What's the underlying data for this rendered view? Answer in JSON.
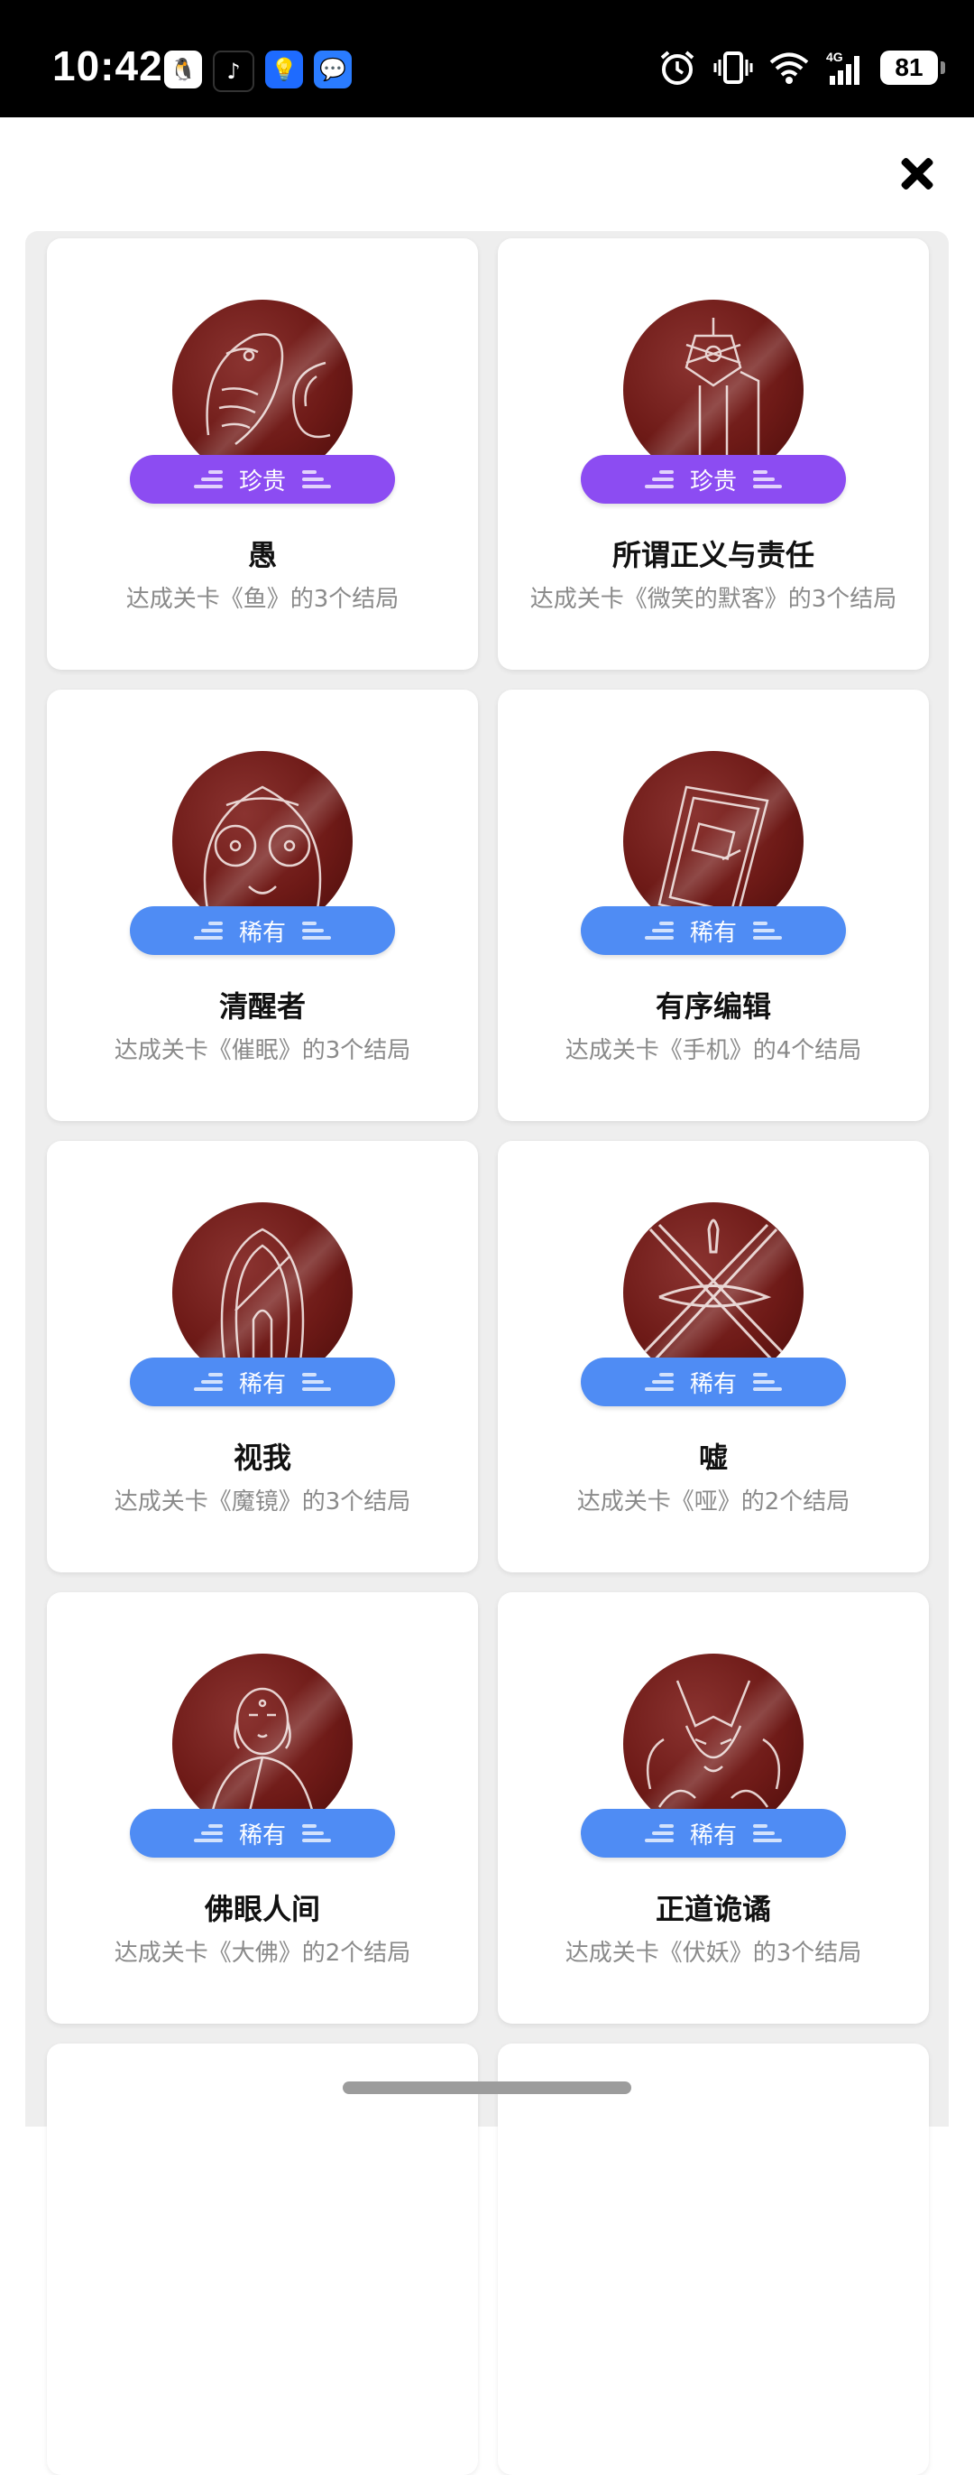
{
  "status_bar": {
    "time": "10:42",
    "apps": [
      "qq-icon",
      "tiktok-icon",
      "bulb-icon",
      "message-icon"
    ],
    "battery": "81",
    "network": "4G"
  },
  "colors": {
    "precious": "#8c4cf2",
    "rare": "#4f8cf4",
    "badge_bg": "#6e1a17"
  },
  "cards": [
    {
      "rarity": "珍贵",
      "rarity_type": "precious",
      "title": "愚",
      "desc": "达成关卡《鱼》的3个结局",
      "icon": "fish-icon"
    },
    {
      "rarity": "珍贵",
      "rarity_type": "precious",
      "title": "所谓正义与责任",
      "desc": "达成关卡《微笑的默客》的3个结局",
      "icon": "sword-icon"
    },
    {
      "rarity": "稀有",
      "rarity_type": "rare",
      "title": "清醒者",
      "desc": "达成关卡《催眠》的3个结局",
      "icon": "face-icon"
    },
    {
      "rarity": "稀有",
      "rarity_type": "rare",
      "title": "有序编辑",
      "desc": "达成关卡《手机》的4个结局",
      "icon": "phone-icon"
    },
    {
      "rarity": "稀有",
      "rarity_type": "rare",
      "title": "视我",
      "desc": "达成关卡《魔镜》的3个结局",
      "icon": "mirror-icon"
    },
    {
      "rarity": "稀有",
      "rarity_type": "rare",
      "title": "嘘",
      "desc": "达成关卡《哑》的2个结局",
      "icon": "cross-icon"
    },
    {
      "rarity": "稀有",
      "rarity_type": "rare",
      "title": "佛眼人间",
      "desc": "达成关卡《大佛》的2个结局",
      "icon": "buddha-icon"
    },
    {
      "rarity": "稀有",
      "rarity_type": "rare",
      "title": "正道诡谲",
      "desc": "达成关卡《伏妖》的3个结局",
      "icon": "fox-icon"
    }
  ]
}
